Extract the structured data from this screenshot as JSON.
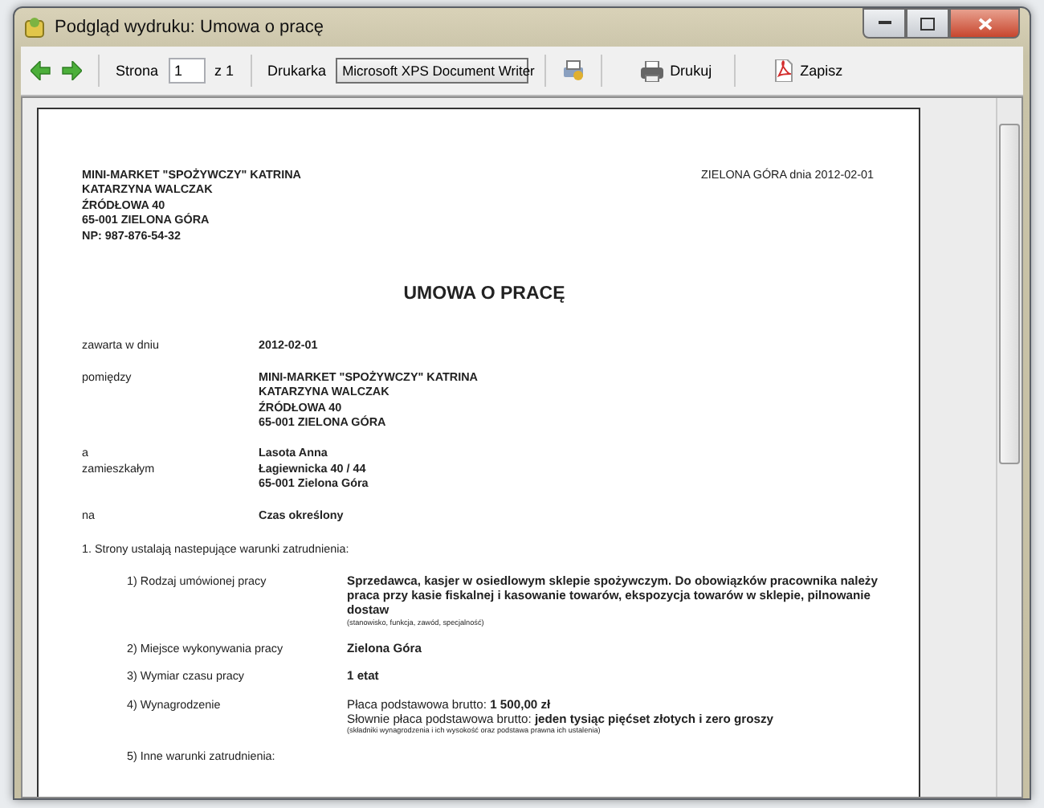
{
  "window": {
    "title": "Podgląd wydruku: Umowa o pracę"
  },
  "toolbar": {
    "page_label": "Strona",
    "page_value": "1",
    "page_total": "z 1",
    "printer_label": "Drukarka",
    "printer_value": "Microsoft XPS Document Writer",
    "print_button": "Drukuj",
    "save_button": "Zapisz"
  },
  "document": {
    "sender": [
      "MINI-MARKET \"SPOŻYWCZY\" KATRINA",
      "KATARZYNA WALCZAK",
      "ŹRÓDŁOWA 40",
      "65-001 ZIELONA GÓRA",
      "NP: **987-876-54-32**"
    ],
    "place_date": "ZIELONA GÓRA dnia 2012-02-01",
    "title": "UMOWA O PRACĘ",
    "parties": [
      {
        "labels": [
          "zawarta w dniu"
        ],
        "values": [
          "2012-02-01"
        ]
      },
      {
        "labels": [
          "pomiędzy"
        ],
        "values": [
          "MINI-MARKET \"SPOŻYWCZY\" KATRINA",
          "KATARZYNA WALCZAK",
          "ŹRÓDŁOWA 40",
          "65-001 ZIELONA GÓRA"
        ]
      },
      {
        "labels": [
          "a",
          "zamieszkałym"
        ],
        "values": [
          "Lasota Anna",
          "Łagiewnicka 40 / 44",
          "65-001 Zielona Góra"
        ]
      },
      {
        "labels": [
          "na"
        ],
        "values": [
          "Czas określony"
        ]
      }
    ],
    "terms_heading": "1. Strony ustalają nastepujące warunki zatrudnienia:",
    "terms": [
      {
        "label": "1) Rodzaj umówionej pracy",
        "values": [
          "**Sprzedawca, kasjer w osiedlowym sklepie spożywczym. Do obowiązków pracownika należy praca przy kasie fiskalnej i kasowanie towarów, ekspozycja towarów w sklepie, pilnowanie dostaw**"
        ],
        "note": "(stanowisko, funkcja, zawód, specjalność)"
      },
      {
        "label": "2) Miejsce wykonywania pracy",
        "values": [
          "**Zielona Góra**"
        ]
      },
      {
        "label": "3) Wymiar czasu pracy",
        "values": [
          "**1 etat**"
        ]
      },
      {
        "label": "4) Wynagrodzenie",
        "values": [
          "Płaca podstawowa brutto: **1 500,00 zł**",
          "Słownie płaca podstawowa brutto: **jeden tysiąc pięćset złotych i zero groszy**"
        ],
        "note": "(składniki wynagrodzenia i ich wysokość oraz podstawa prawna ich ustalenia)"
      },
      {
        "label": "5) Inne warunki zatrudnienia:"
      }
    ]
  }
}
